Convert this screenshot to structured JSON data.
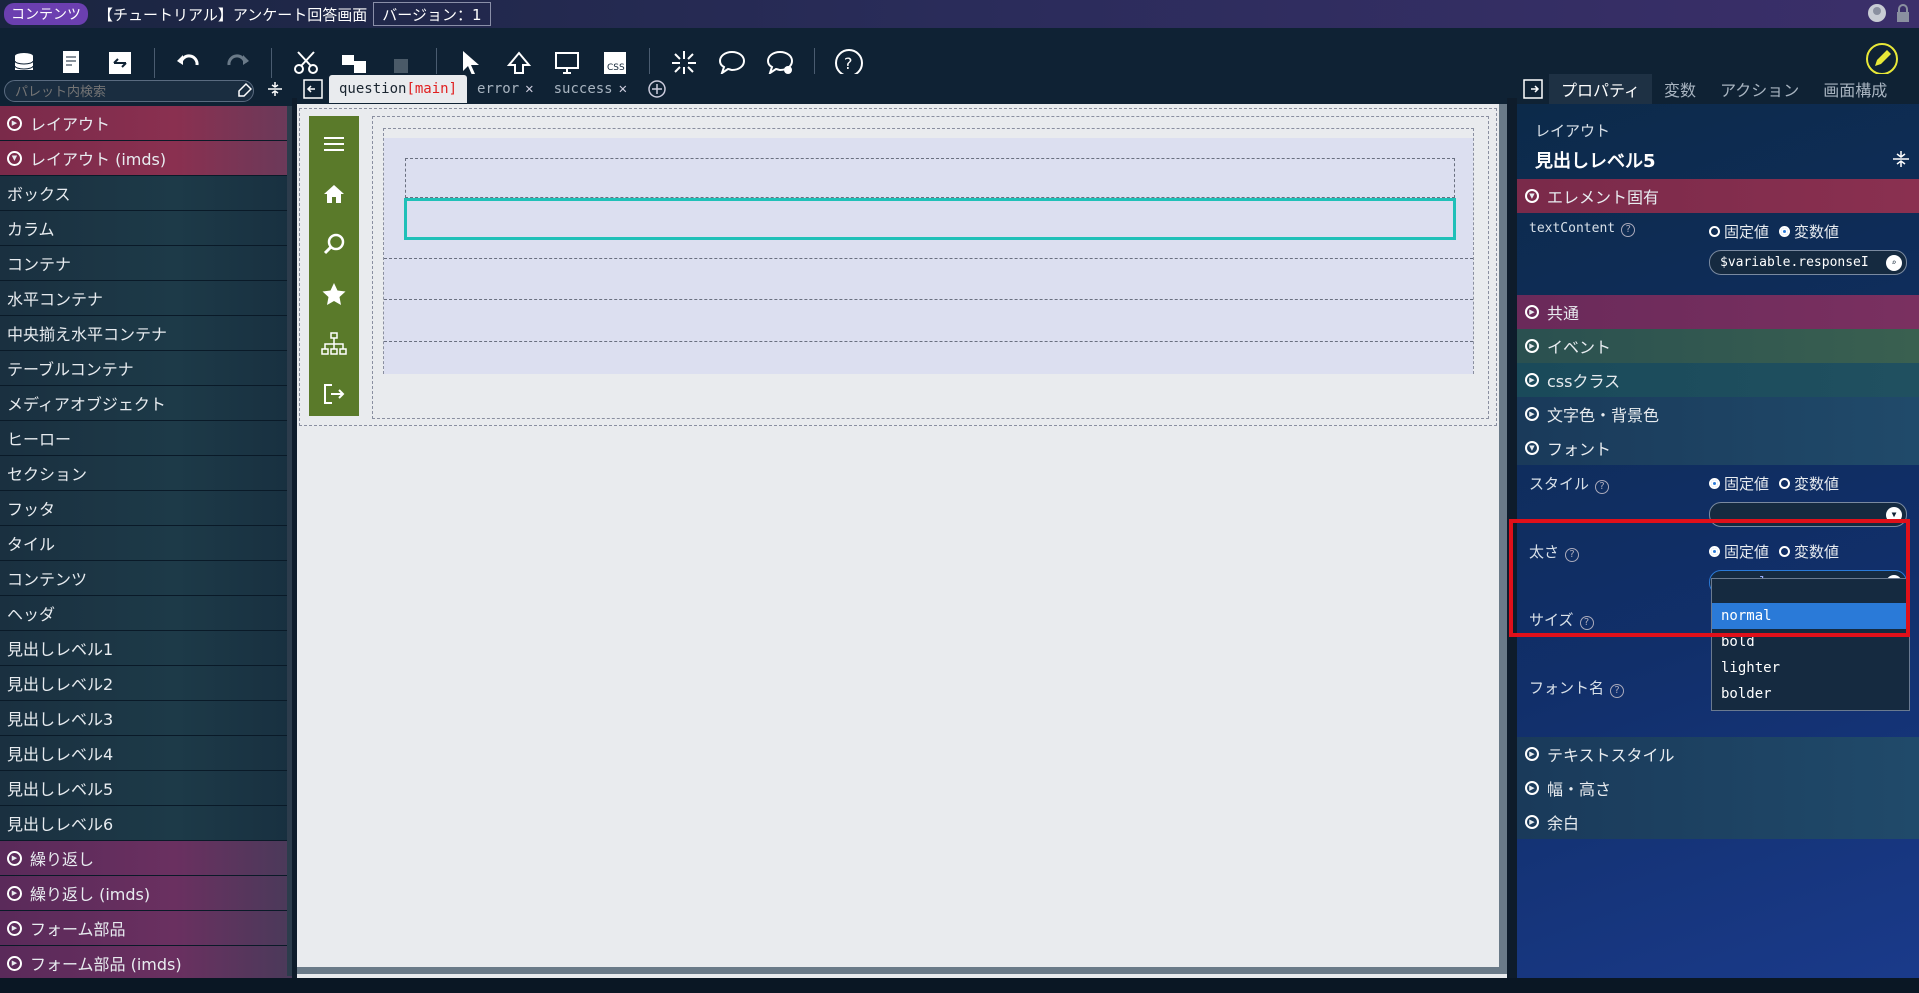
{
  "titlebar": {
    "badge": "コンテンツ",
    "title": "【チュートリアル】アンケート回答画面",
    "version": "バージョン：1"
  },
  "left": {
    "search_placeholder": "パレット内検索",
    "items": [
      {
        "label": "レイアウト",
        "type": "cat"
      },
      {
        "label": "レイアウト (imds)",
        "type": "cat"
      },
      {
        "label": "ボックス",
        "type": "sub"
      },
      {
        "label": "カラム",
        "type": "sub"
      },
      {
        "label": "コンテナ",
        "type": "sub"
      },
      {
        "label": "水平コンテナ",
        "type": "sub"
      },
      {
        "label": "中央揃え水平コンテナ",
        "type": "sub"
      },
      {
        "label": "テーブルコンテナ",
        "type": "sub"
      },
      {
        "label": "メディアオブジェクト",
        "type": "sub"
      },
      {
        "label": "ヒーロー",
        "type": "sub"
      },
      {
        "label": "セクション",
        "type": "sub"
      },
      {
        "label": "フッタ",
        "type": "sub"
      },
      {
        "label": "タイル",
        "type": "sub"
      },
      {
        "label": "コンテンツ",
        "type": "sub"
      },
      {
        "label": "ヘッダ",
        "type": "sub"
      },
      {
        "label": "見出しレベル1",
        "type": "sub"
      },
      {
        "label": "見出しレベル2",
        "type": "sub"
      },
      {
        "label": "見出しレベル3",
        "type": "sub"
      },
      {
        "label": "見出しレベル4",
        "type": "sub"
      },
      {
        "label": "見出しレベル5",
        "type": "sub"
      },
      {
        "label": "見出しレベル6",
        "type": "sub"
      },
      {
        "label": "繰り返し",
        "type": "catb"
      },
      {
        "label": "繰り返し (imds)",
        "type": "catb"
      },
      {
        "label": "フォーム部品",
        "type": "catb"
      },
      {
        "label": "フォーム部品 (imds)",
        "type": "catb"
      }
    ]
  },
  "tabs": [
    {
      "label": "question",
      "badge": "[main]"
    },
    {
      "label": "error"
    },
    {
      "label": "success"
    }
  ],
  "right": {
    "tabs": [
      "プロパティ",
      "変数",
      "アクション",
      "画面構成"
    ],
    "breadcrumb": "レイアウト",
    "element_title": "見出しレベル5",
    "sec_element": "エレメント固有",
    "prop_text_label": "textContent",
    "fixed": "固定値",
    "variable": "変数値",
    "text_value": "$variable.responseI",
    "sec_common": "共通",
    "sec_event": "イベント",
    "sec_css": "cssクラス",
    "sec_color": "文字色・背景色",
    "sec_font": "フォント",
    "prop_style": "スタイル",
    "prop_weight": "太さ",
    "weight_value": "normal",
    "prop_size": "サイズ",
    "prop_fontname": "フォント名",
    "options": [
      "normal",
      "bold",
      "lighter",
      "bolder"
    ],
    "sec_textstyle": "テキストスタイル",
    "sec_wh": "幅・高さ",
    "sec_margin": "余白"
  }
}
